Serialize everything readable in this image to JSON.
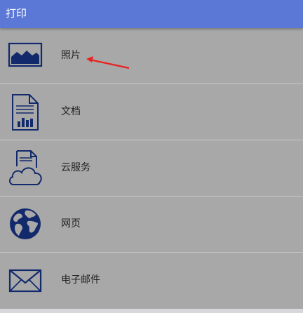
{
  "header": {
    "title": "打印"
  },
  "items": [
    {
      "label": "照片",
      "icon": "photo-icon"
    },
    {
      "label": "文档",
      "icon": "document-icon"
    },
    {
      "label": "云服务",
      "icon": "cloud-service-icon"
    },
    {
      "label": "网页",
      "icon": "globe-icon"
    },
    {
      "label": "电子邮件",
      "icon": "email-icon"
    }
  ],
  "colors": {
    "header_bg": "#5b78d6",
    "list_bg": "#a8a8a8",
    "icon_color": "#12296b",
    "annotation_arrow": "#e8231f"
  }
}
